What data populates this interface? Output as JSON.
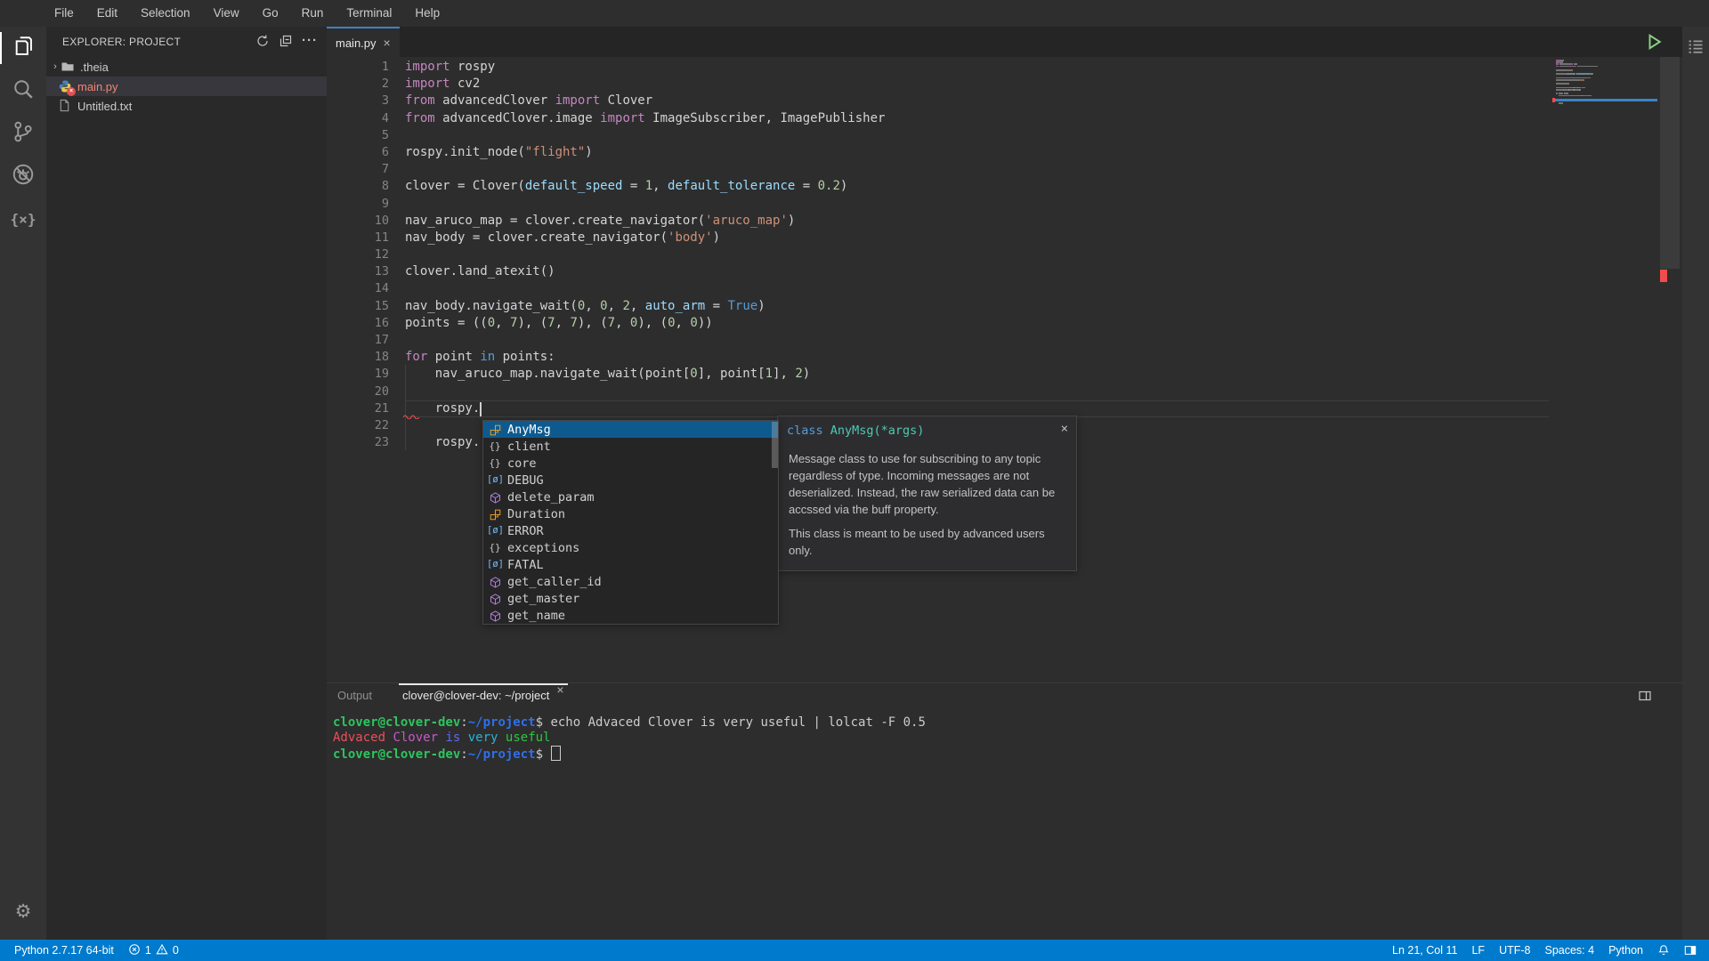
{
  "ui": {
    "close_glyph": "×",
    "more_glyph": "···",
    "chevron_right": "›"
  },
  "colors": {
    "accent": "#007acc",
    "tabind": "#3c84c4",
    "sel": "#0e5a8f",
    "error": "#f14c4c",
    "kw": "#c586c0",
    "kw2": "#569cd6",
    "str": "#ce9178",
    "num": "#b5cea8",
    "param": "#9cdcfe",
    "pl": "#d4d4d4",
    "doctype": "#4ec9b0",
    "tuser": "#2dc55e",
    "tpath": "#2f6feb",
    "class_icon": "#ee9d28",
    "method_icon": "#b180d7",
    "constant_icon": "#75beff",
    "module_icon": "#c5c5c5"
  },
  "menu_bar": {
    "items": [
      "File",
      "Edit",
      "Selection",
      "View",
      "Go",
      "Run",
      "Terminal",
      "Help"
    ]
  },
  "activity_bar": {
    "top": [
      {
        "id": "explorer",
        "icon": "files-icon",
        "active": true
      },
      {
        "id": "search",
        "icon": "search-icon",
        "active": false
      },
      {
        "id": "source-control",
        "icon": "source-control-icon",
        "active": false
      },
      {
        "id": "debug",
        "icon": "debug-icon",
        "active": false
      },
      {
        "id": "plugins",
        "icon": "plugins-icon",
        "active": false,
        "glyph": "{×}"
      }
    ],
    "bottom": [
      {
        "id": "settings",
        "icon": "gear-icon",
        "glyph": "⚙"
      }
    ]
  },
  "explorer": {
    "title": "EXPLORER: PROJECT",
    "toolbar": [
      {
        "id": "refresh",
        "icon": "refresh-icon"
      },
      {
        "id": "collapse-all",
        "icon": "collapse-all-icon"
      },
      {
        "id": "more-actions",
        "icon": "more-icon"
      }
    ],
    "files": [
      {
        "name": ".theia",
        "type": "folder",
        "expanded": false
      },
      {
        "name": "main.py",
        "type": "python",
        "selected": true,
        "has_error": true
      },
      {
        "name": "Untitled.txt",
        "type": "text"
      }
    ]
  },
  "editor": {
    "tab_label": "main.py",
    "cursor": {
      "line": 21,
      "col": 11
    },
    "code_lines": [
      [
        [
          "kw",
          "import"
        ],
        [
          "pl",
          " rospy"
        ]
      ],
      [
        [
          "kw",
          "import"
        ],
        [
          "pl",
          " cv2"
        ]
      ],
      [
        [
          "kw",
          "from"
        ],
        [
          "pl",
          " advancedClover "
        ],
        [
          "kw",
          "import"
        ],
        [
          "pl",
          " Clover"
        ]
      ],
      [
        [
          "kw",
          "from"
        ],
        [
          "pl",
          " advancedClover.image "
        ],
        [
          "kw",
          "import"
        ],
        [
          "pl",
          " ImageSubscriber, ImagePublisher"
        ]
      ],
      [],
      [
        [
          "pl",
          "rospy.init_node("
        ],
        [
          "str",
          "\"flight\""
        ],
        [
          "pl",
          ")"
        ]
      ],
      [],
      [
        [
          "pl",
          "clover = Clover("
        ],
        [
          "param",
          "default_speed"
        ],
        [
          "pl",
          " = "
        ],
        [
          "num",
          "1"
        ],
        [
          "pl",
          ", "
        ],
        [
          "param",
          "default_tolerance"
        ],
        [
          "pl",
          " = "
        ],
        [
          "num",
          "0.2"
        ],
        [
          "pl",
          ")"
        ]
      ],
      [],
      [
        [
          "pl",
          "nav_aruco_map = clover.create_navigator("
        ],
        [
          "str",
          "'aruco_map'"
        ],
        [
          "pl",
          ")"
        ]
      ],
      [
        [
          "pl",
          "nav_body = clover.create_navigator("
        ],
        [
          "str",
          "'body'"
        ],
        [
          "pl",
          ")"
        ]
      ],
      [],
      [
        [
          "pl",
          "clover.land_atexit()"
        ]
      ],
      [],
      [
        [
          "pl",
          "nav_body.navigate_wait("
        ],
        [
          "num",
          "0"
        ],
        [
          "pl",
          ", "
        ],
        [
          "num",
          "0"
        ],
        [
          "pl",
          ", "
        ],
        [
          "num",
          "2"
        ],
        [
          "pl",
          ", "
        ],
        [
          "param",
          "auto_arm"
        ],
        [
          "pl",
          " = "
        ],
        [
          "kw2",
          "True"
        ],
        [
          "pl",
          ")"
        ]
      ],
      [
        [
          "pl",
          "points = (("
        ],
        [
          "num",
          "0"
        ],
        [
          "pl",
          ", "
        ],
        [
          "num",
          "7"
        ],
        [
          "pl",
          "), ("
        ],
        [
          "num",
          "7"
        ],
        [
          "pl",
          ", "
        ],
        [
          "num",
          "7"
        ],
        [
          "pl",
          "), ("
        ],
        [
          "num",
          "7"
        ],
        [
          "pl",
          ", "
        ],
        [
          "num",
          "0"
        ],
        [
          "pl",
          "), ("
        ],
        [
          "num",
          "0"
        ],
        [
          "pl",
          ", "
        ],
        [
          "num",
          "0"
        ],
        [
          "pl",
          "))"
        ]
      ],
      [],
      [
        [
          "kw",
          "for"
        ],
        [
          "pl",
          " point "
        ],
        [
          "kw2",
          "in"
        ],
        [
          "pl",
          " points:"
        ]
      ],
      [
        [
          "pl",
          "    nav_aruco_map.navigate_wait(point["
        ],
        [
          "num",
          "0"
        ],
        [
          "pl",
          "], point["
        ],
        [
          "num",
          "1"
        ],
        [
          "pl",
          "], "
        ],
        [
          "num",
          "2"
        ],
        [
          "pl",
          ")"
        ]
      ],
      [],
      [
        [
          "pl",
          "    rospy."
        ]
      ],
      [],
      [
        [
          "pl",
          "    rospy."
        ]
      ]
    ]
  },
  "completion": {
    "items": [
      {
        "label": "AnyMsg",
        "kind": "class",
        "selected": true
      },
      {
        "label": "client",
        "kind": "module"
      },
      {
        "label": "core",
        "kind": "module"
      },
      {
        "label": "DEBUG",
        "kind": "constant"
      },
      {
        "label": "delete_param",
        "kind": "method"
      },
      {
        "label": "Duration",
        "kind": "class"
      },
      {
        "label": "ERROR",
        "kind": "constant"
      },
      {
        "label": "exceptions",
        "kind": "module"
      },
      {
        "label": "FATAL",
        "kind": "constant"
      },
      {
        "label": "get_caller_id",
        "kind": "method"
      },
      {
        "label": "get_master",
        "kind": "method"
      },
      {
        "label": "get_name",
        "kind": "method"
      }
    ],
    "kind_glyphs": {
      "module": "{}",
      "constant": "[ø]"
    }
  },
  "doc_popup": {
    "keyword": "class",
    "signature": " AnyMsg(*args)",
    "paragraphs": [
      "Message class to use for subscribing to any topic regardless of type. Incoming messages are not deserialized. Instead, the raw serialized data can be accssed via the buff property.",
      "This class is meant to be used by advanced users only."
    ]
  },
  "panel": {
    "tabs": [
      {
        "label": "Output",
        "active": false
      },
      {
        "label": "clover@clover-dev: ~/project",
        "active": true,
        "closable": true
      }
    ],
    "terminal_lines": [
      {
        "segments": [
          [
            "user",
            "clover@clover-dev"
          ],
          [
            "pl",
            ":"
          ],
          [
            "path",
            "~/project"
          ],
          [
            "pl",
            "$ echo Advaced Clover is very useful  | lolcat -F 0.5"
          ]
        ]
      },
      {
        "rainbow": [
          [
            "#ef4d59",
            "Advaced"
          ],
          [
            "#c957c9",
            "Clover"
          ],
          [
            "#5c6bf2",
            "is"
          ],
          [
            "#2bb3d8",
            "very"
          ],
          [
            "#27c93f",
            "useful"
          ]
        ]
      },
      {
        "segments": [
          [
            "user",
            "clover@clover-dev"
          ],
          [
            "pl",
            ":"
          ],
          [
            "path",
            "~/project"
          ],
          [
            "pl",
            "$ "
          ]
        ],
        "cursor": true
      }
    ]
  },
  "status_bar": {
    "left": [
      {
        "id": "interpreter",
        "label": "Python 2.7.17 64-bit"
      },
      {
        "id": "problems",
        "error_count": "1",
        "warning_count": "0"
      }
    ],
    "right": [
      {
        "id": "cursor-position",
        "label": "Ln 21, Col 11"
      },
      {
        "id": "eol",
        "label": "LF"
      },
      {
        "id": "encoding",
        "label": "UTF-8"
      },
      {
        "id": "indentation",
        "label": "Spaces: 4"
      },
      {
        "id": "language-mode",
        "label": "Python"
      }
    ]
  }
}
